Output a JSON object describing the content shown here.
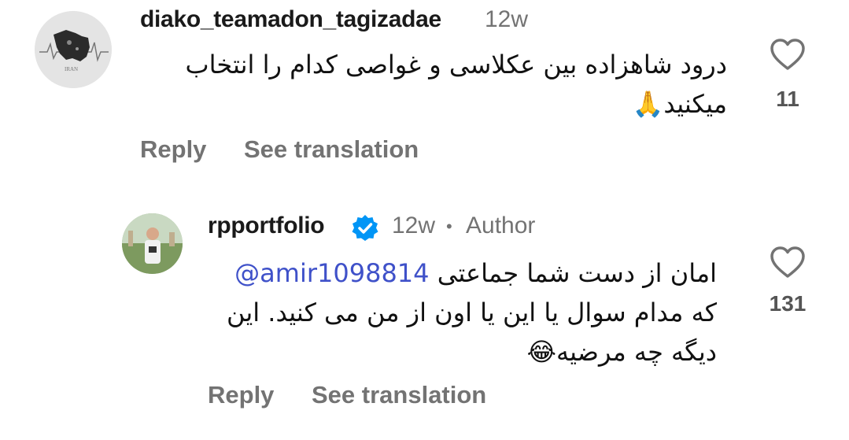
{
  "comments": [
    {
      "username": "diako_teamadon_tagizadae",
      "time": "12w",
      "avatar_text": "IRAN",
      "text_lines": [
        "درود شاهزاده بین عکلاسی و غواصی کدام را انتخاب",
        "میکنید🙏"
      ],
      "likes": "11",
      "reply_label": "Reply",
      "translate_label": "See translation"
    },
    {
      "username": "rpportfolio",
      "verified": true,
      "time": "12w",
      "separator": "•",
      "author_label": "Author",
      "mention": "@amir1098814",
      "text_lines": [
        "امان از دست شما جماعتی",
        "که مدام سوال یا این یا اون از من می کنید. این",
        "دیگه چه مرضیه😂"
      ],
      "likes": "131",
      "reply_label": "Reply",
      "translate_label": "See translation"
    }
  ],
  "colors": {
    "verified": "#0095f6",
    "mention": "#3f51c9",
    "muted": "#737373"
  }
}
